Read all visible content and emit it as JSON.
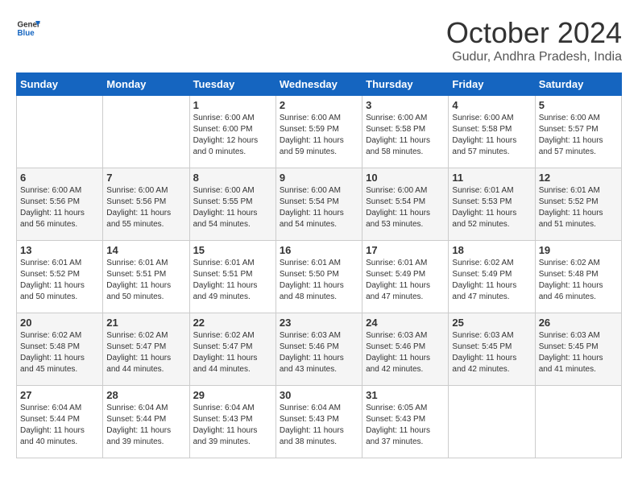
{
  "header": {
    "logo": {
      "line1": "General",
      "line2": "Blue"
    },
    "title": "October 2024",
    "subtitle": "Gudur, Andhra Pradesh, India"
  },
  "days_of_week": [
    "Sunday",
    "Monday",
    "Tuesday",
    "Wednesday",
    "Thursday",
    "Friday",
    "Saturday"
  ],
  "weeks": [
    [
      {
        "day": "",
        "info": ""
      },
      {
        "day": "",
        "info": ""
      },
      {
        "day": "1",
        "info": "Sunrise: 6:00 AM\nSunset: 6:00 PM\nDaylight: 12 hours and 0 minutes."
      },
      {
        "day": "2",
        "info": "Sunrise: 6:00 AM\nSunset: 5:59 PM\nDaylight: 11 hours and 59 minutes."
      },
      {
        "day": "3",
        "info": "Sunrise: 6:00 AM\nSunset: 5:58 PM\nDaylight: 11 hours and 58 minutes."
      },
      {
        "day": "4",
        "info": "Sunrise: 6:00 AM\nSunset: 5:58 PM\nDaylight: 11 hours and 57 minutes."
      },
      {
        "day": "5",
        "info": "Sunrise: 6:00 AM\nSunset: 5:57 PM\nDaylight: 11 hours and 57 minutes."
      }
    ],
    [
      {
        "day": "6",
        "info": "Sunrise: 6:00 AM\nSunset: 5:56 PM\nDaylight: 11 hours and 56 minutes."
      },
      {
        "day": "7",
        "info": "Sunrise: 6:00 AM\nSunset: 5:56 PM\nDaylight: 11 hours and 55 minutes."
      },
      {
        "day": "8",
        "info": "Sunrise: 6:00 AM\nSunset: 5:55 PM\nDaylight: 11 hours and 54 minutes."
      },
      {
        "day": "9",
        "info": "Sunrise: 6:00 AM\nSunset: 5:54 PM\nDaylight: 11 hours and 54 minutes."
      },
      {
        "day": "10",
        "info": "Sunrise: 6:00 AM\nSunset: 5:54 PM\nDaylight: 11 hours and 53 minutes."
      },
      {
        "day": "11",
        "info": "Sunrise: 6:01 AM\nSunset: 5:53 PM\nDaylight: 11 hours and 52 minutes."
      },
      {
        "day": "12",
        "info": "Sunrise: 6:01 AM\nSunset: 5:52 PM\nDaylight: 11 hours and 51 minutes."
      }
    ],
    [
      {
        "day": "13",
        "info": "Sunrise: 6:01 AM\nSunset: 5:52 PM\nDaylight: 11 hours and 50 minutes."
      },
      {
        "day": "14",
        "info": "Sunrise: 6:01 AM\nSunset: 5:51 PM\nDaylight: 11 hours and 50 minutes."
      },
      {
        "day": "15",
        "info": "Sunrise: 6:01 AM\nSunset: 5:51 PM\nDaylight: 11 hours and 49 minutes."
      },
      {
        "day": "16",
        "info": "Sunrise: 6:01 AM\nSunset: 5:50 PM\nDaylight: 11 hours and 48 minutes."
      },
      {
        "day": "17",
        "info": "Sunrise: 6:01 AM\nSunset: 5:49 PM\nDaylight: 11 hours and 47 minutes."
      },
      {
        "day": "18",
        "info": "Sunrise: 6:02 AM\nSunset: 5:49 PM\nDaylight: 11 hours and 47 minutes."
      },
      {
        "day": "19",
        "info": "Sunrise: 6:02 AM\nSunset: 5:48 PM\nDaylight: 11 hours and 46 minutes."
      }
    ],
    [
      {
        "day": "20",
        "info": "Sunrise: 6:02 AM\nSunset: 5:48 PM\nDaylight: 11 hours and 45 minutes."
      },
      {
        "day": "21",
        "info": "Sunrise: 6:02 AM\nSunset: 5:47 PM\nDaylight: 11 hours and 44 minutes."
      },
      {
        "day": "22",
        "info": "Sunrise: 6:02 AM\nSunset: 5:47 PM\nDaylight: 11 hours and 44 minutes."
      },
      {
        "day": "23",
        "info": "Sunrise: 6:03 AM\nSunset: 5:46 PM\nDaylight: 11 hours and 43 minutes."
      },
      {
        "day": "24",
        "info": "Sunrise: 6:03 AM\nSunset: 5:46 PM\nDaylight: 11 hours and 42 minutes."
      },
      {
        "day": "25",
        "info": "Sunrise: 6:03 AM\nSunset: 5:45 PM\nDaylight: 11 hours and 42 minutes."
      },
      {
        "day": "26",
        "info": "Sunrise: 6:03 AM\nSunset: 5:45 PM\nDaylight: 11 hours and 41 minutes."
      }
    ],
    [
      {
        "day": "27",
        "info": "Sunrise: 6:04 AM\nSunset: 5:44 PM\nDaylight: 11 hours and 40 minutes."
      },
      {
        "day": "28",
        "info": "Sunrise: 6:04 AM\nSunset: 5:44 PM\nDaylight: 11 hours and 39 minutes."
      },
      {
        "day": "29",
        "info": "Sunrise: 6:04 AM\nSunset: 5:43 PM\nDaylight: 11 hours and 39 minutes."
      },
      {
        "day": "30",
        "info": "Sunrise: 6:04 AM\nSunset: 5:43 PM\nDaylight: 11 hours and 38 minutes."
      },
      {
        "day": "31",
        "info": "Sunrise: 6:05 AM\nSunset: 5:43 PM\nDaylight: 11 hours and 37 minutes."
      },
      {
        "day": "",
        "info": ""
      },
      {
        "day": "",
        "info": ""
      }
    ]
  ]
}
